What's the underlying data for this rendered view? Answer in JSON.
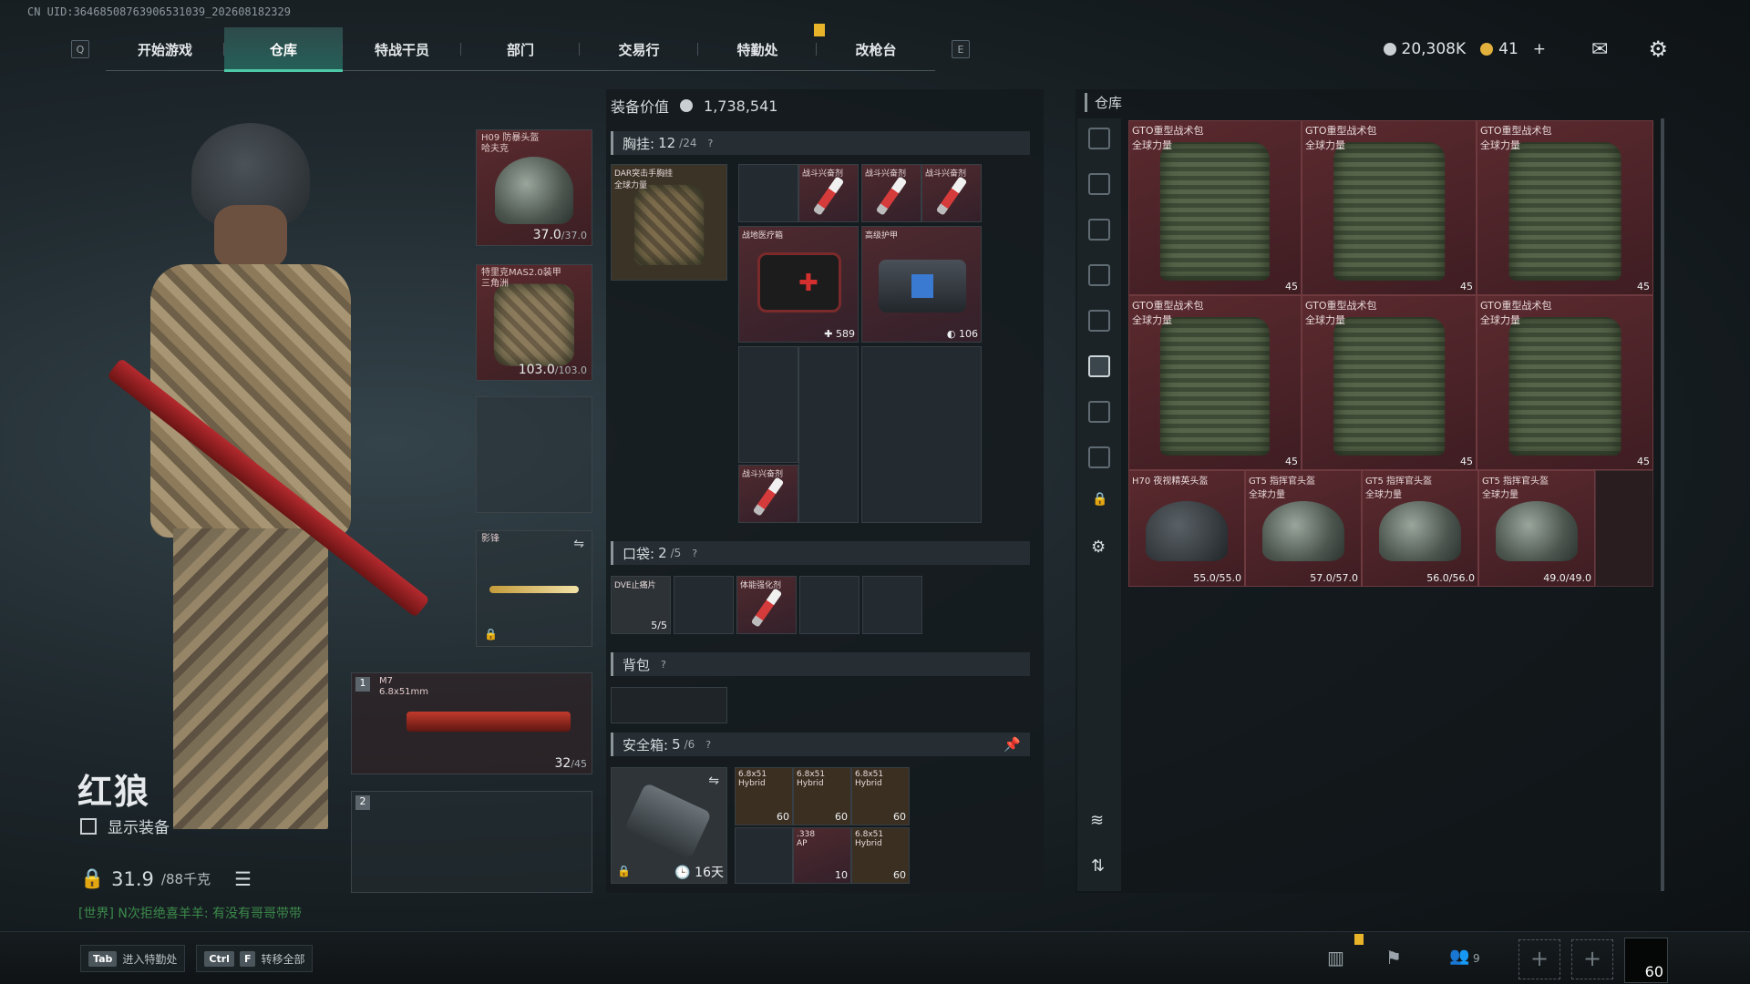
{
  "uid": "CN UID:36468508763906531039_202608182329",
  "nav": {
    "left_key": "Q",
    "right_key": "E",
    "tabs": [
      "开始游戏",
      "仓库",
      "特战干员",
      "部门",
      "交易行",
      "特勤处",
      "改枪台"
    ],
    "active": 1
  },
  "currency": {
    "silver": "20,308K",
    "gold": "41",
    "plus": "+"
  },
  "character": {
    "name": "红狼",
    "show_equip": "显示装备",
    "weight": "31.9",
    "weight_unit": "/88千克"
  },
  "chat": "[世界] N次拒绝喜羊羊: 有没有哥哥带带",
  "shortcuts": [
    {
      "key": "Tab",
      "label": "进入特勤处"
    },
    {
      "key": "Ctrl",
      "key2": "F",
      "label": "转移全部"
    }
  ],
  "gear": {
    "helmet": {
      "name": "H09 防暴头盔",
      "sub": "哈夫克",
      "val": "37.0",
      "max": "/37.0"
    },
    "armor": {
      "name": "特里克MAS2.0装甲",
      "sub": "三角洲",
      "val": "103.0",
      "max": "/103.0"
    },
    "melee": {
      "name": "影锋"
    },
    "primary": {
      "slot": "1",
      "name": "M7",
      "ammo": "6.8x51mm",
      "val": "32",
      "max": "/45"
    },
    "secondary": {
      "slot": "2"
    }
  },
  "equip_value": {
    "label": "装备价值",
    "value": "1,738,541"
  },
  "chest": {
    "label": "胸挂:",
    "count": "12",
    "max": "/24",
    "q": "?",
    "item": "DAR突击手胸挂",
    "item_sub": "全球力量",
    "items": [
      {
        "name": "战斗兴奋剂"
      },
      {
        "name": "战斗兴奋剂"
      },
      {
        "name": "战斗兴奋剂"
      },
      {
        "name": "战地医疗箱",
        "val": "✚ 589"
      },
      {
        "name": "高级护甲",
        "val": "◐ 106"
      },
      {
        "name": "战斗兴奋剂"
      }
    ]
  },
  "pocket": {
    "label": "口袋:",
    "count": "2",
    "max": "/5",
    "q": "?",
    "items": [
      {
        "name": "DVE止痛片",
        "val": "5/5"
      },
      {
        "name": "体能强化剂"
      }
    ]
  },
  "backpack": {
    "label": "背包",
    "q": "?"
  },
  "safebox": {
    "label": "安全箱:",
    "count": "5",
    "max": "/6",
    "q": "?",
    "time": "16天",
    "items": [
      {
        "name": "6.8x51",
        "sub": "Hybrid",
        "val": "60"
      },
      {
        "name": "6.8x51",
        "sub": "Hybrid",
        "val": "60"
      },
      {
        "name": "6.8x51",
        "sub": "Hybrid",
        "val": "60"
      },
      {
        "name": ".338",
        "sub": "AP",
        "val": "10"
      },
      {
        "name": "6.8x51",
        "sub": "Hybrid",
        "val": "60"
      }
    ]
  },
  "warehouse": {
    "label": "仓库",
    "items": [
      {
        "name": "GTO重型战术包",
        "sub": "全球力量",
        "val": "45"
      },
      {
        "name": "GTO重型战术包",
        "sub": "全球力量",
        "val": "45"
      },
      {
        "name": "GTO重型战术包",
        "sub": "全球力量",
        "val": "45"
      },
      {
        "name": "GTO重型战术包",
        "sub": "全球力量",
        "val": "45"
      },
      {
        "name": "GTO重型战术包",
        "sub": "全球力量",
        "val": "45"
      },
      {
        "name": "GTO重型战术包",
        "sub": "全球力量",
        "val": "45"
      },
      {
        "name": "H70 夜视精英头盔",
        "val": "55.0/55.0"
      },
      {
        "name": "GT5 指挥官头盔",
        "sub": "全球力量",
        "val": "57.0/57.0"
      },
      {
        "name": "GT5 指挥官头盔",
        "sub": "全球力量",
        "val": "56.0/56.0"
      },
      {
        "name": "GT5 指挥官头盔",
        "sub": "全球力量",
        "val": "49.0/49.0"
      }
    ]
  },
  "bottom": {
    "friends": "9",
    "fps": "60"
  }
}
